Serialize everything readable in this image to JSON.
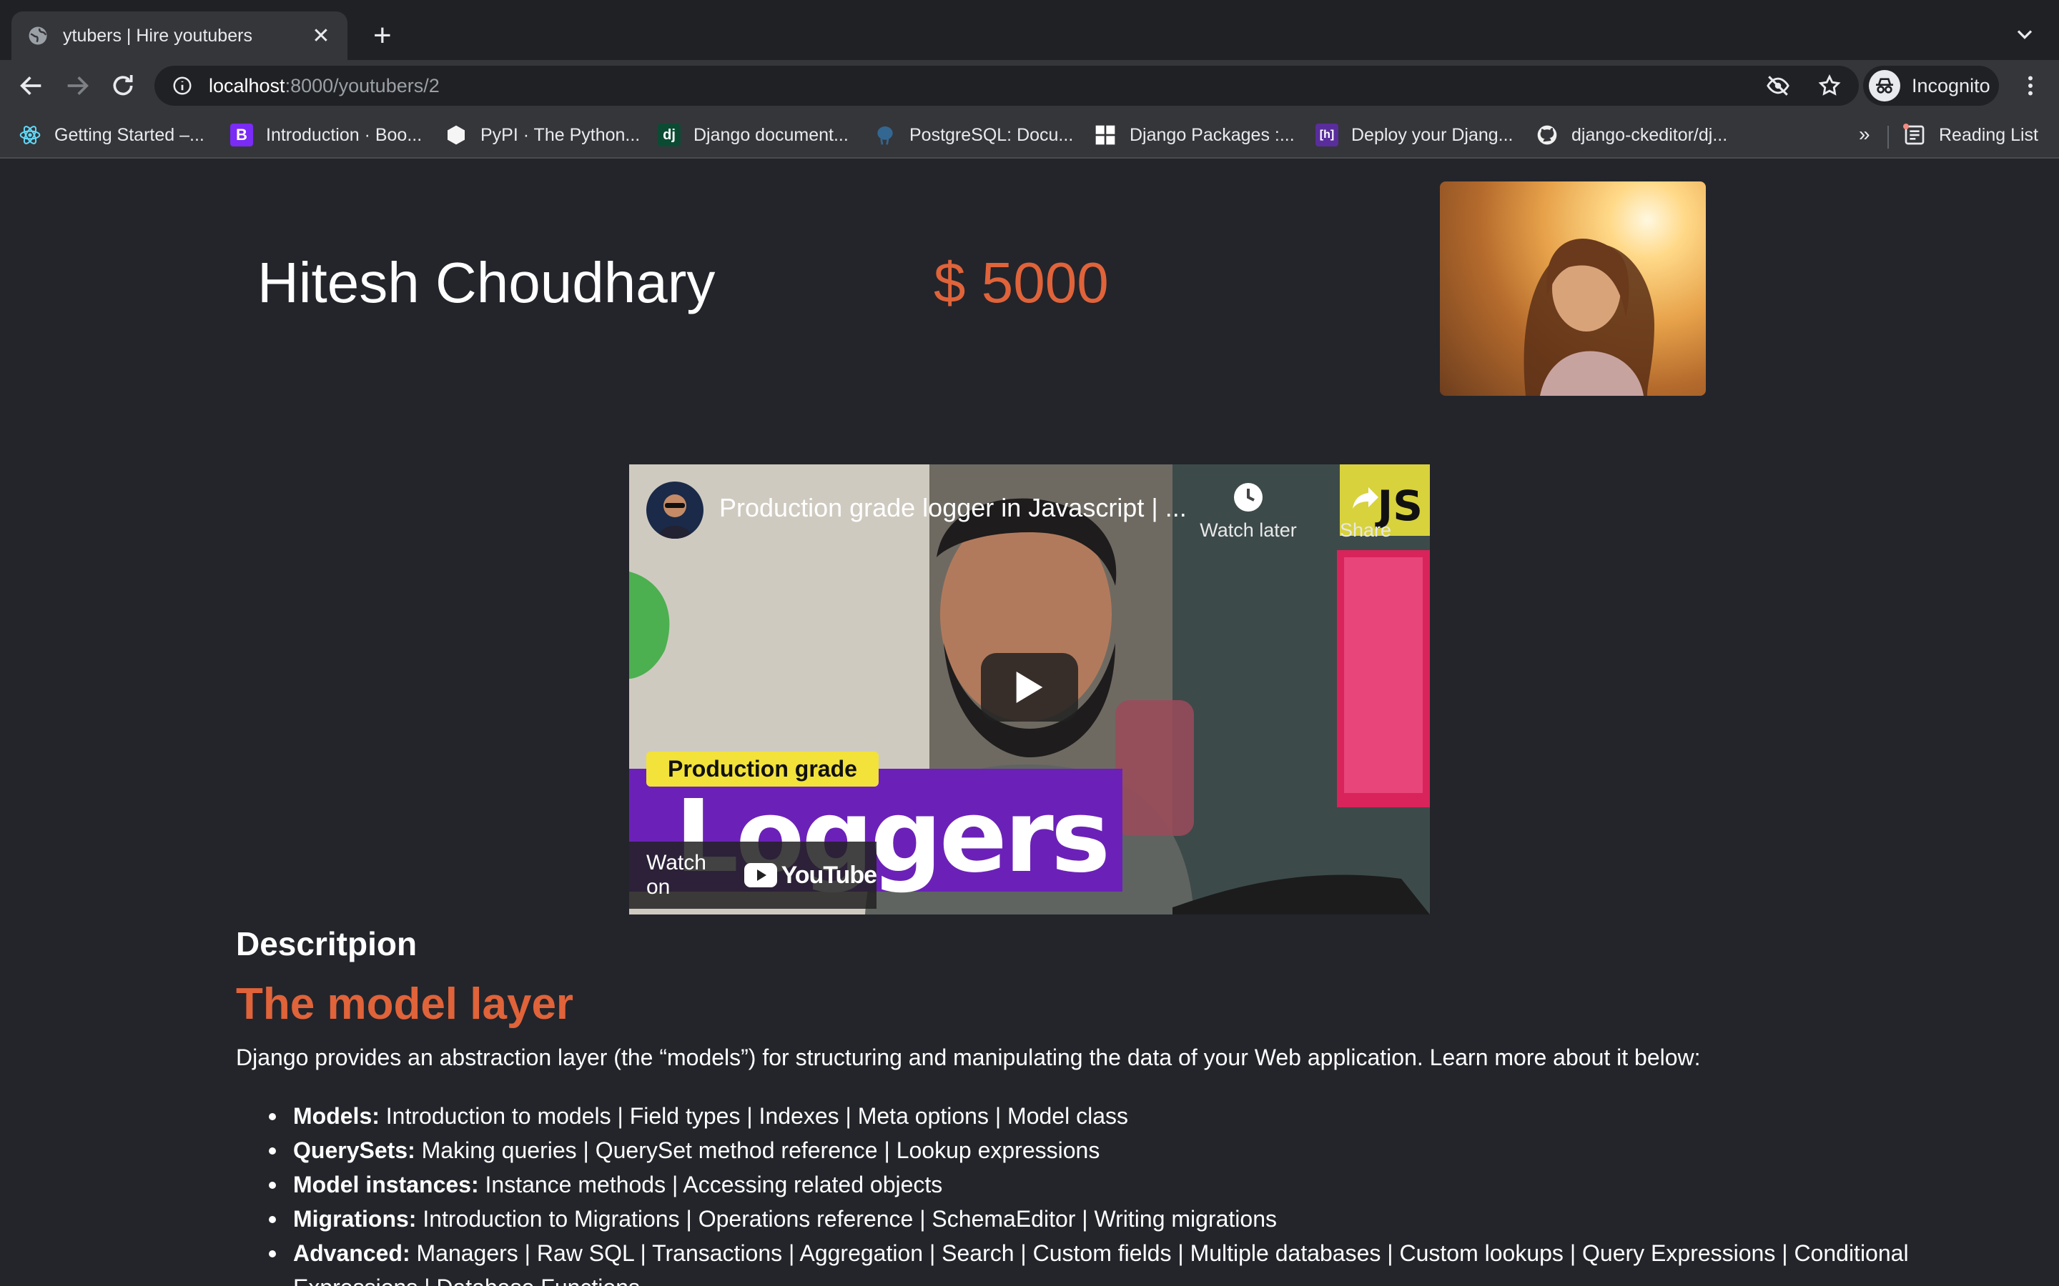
{
  "browser": {
    "tab_title": "ytubers | Hire youtubers",
    "url_host": "localhost",
    "url_path": ":8000/youtubers/2",
    "profile_label": "Incognito",
    "bookmarks": [
      {
        "label": "Getting Started –...",
        "icon": "react-icon"
      },
      {
        "label": "Introduction · Boo...",
        "icon": "bootstrap-icon"
      },
      {
        "label": "PyPI · The Python...",
        "icon": "pypi-icon"
      },
      {
        "label": "Django document...",
        "icon": "django-icon"
      },
      {
        "label": "PostgreSQL: Docu...",
        "icon": "postgresql-icon"
      },
      {
        "label": "Django Packages :...",
        "icon": "django-packages-icon"
      },
      {
        "label": "Deploy your Djang...",
        "icon": "heroku-icon"
      },
      {
        "label": "django-ckeditor/dj...",
        "icon": "github-icon"
      }
    ],
    "bookmarks_overflow": "»",
    "reading_list": "Reading List"
  },
  "profile": {
    "name": "Hitesh Choudhary",
    "price": "$ 5000"
  },
  "video": {
    "title": "Production grade logger in Javascript | ...",
    "watch_later": "Watch later",
    "share": "Share",
    "badge": "JS",
    "label": "Production grade",
    "headline": "Loggers",
    "watch_on": "Watch on",
    "youtube": "YouTube"
  },
  "description": {
    "heading": "Descritpion",
    "subheading": "The model layer",
    "intro": "Django provides an abstraction layer (the “models”) for structuring and manipulating the data of your Web application. Learn more about it below:",
    "items": [
      {
        "term": "Models:",
        "text": " Introduction to models | Field types | Indexes | Meta options | Model class"
      },
      {
        "term": "QuerySets:",
        "text": " Making queries | QuerySet method reference | Lookup expressions"
      },
      {
        "term": "Model instances:",
        "text": " Instance methods | Accessing related objects"
      },
      {
        "term": "Migrations:",
        "text": " Introduction to Migrations | Operations reference | SchemaEditor | Writing migrations"
      },
      {
        "term": "Advanced:",
        "text": " Managers | Raw SQL | Transactions | Aggregation | Search | Custom fields | Multiple databases | Custom lookups | Query Expressions | Conditional Expressions | Database Functions"
      }
    ]
  },
  "colors": {
    "accent": "#e0633a",
    "page_bg": "#23252b",
    "chrome_bg": "#35363a"
  }
}
